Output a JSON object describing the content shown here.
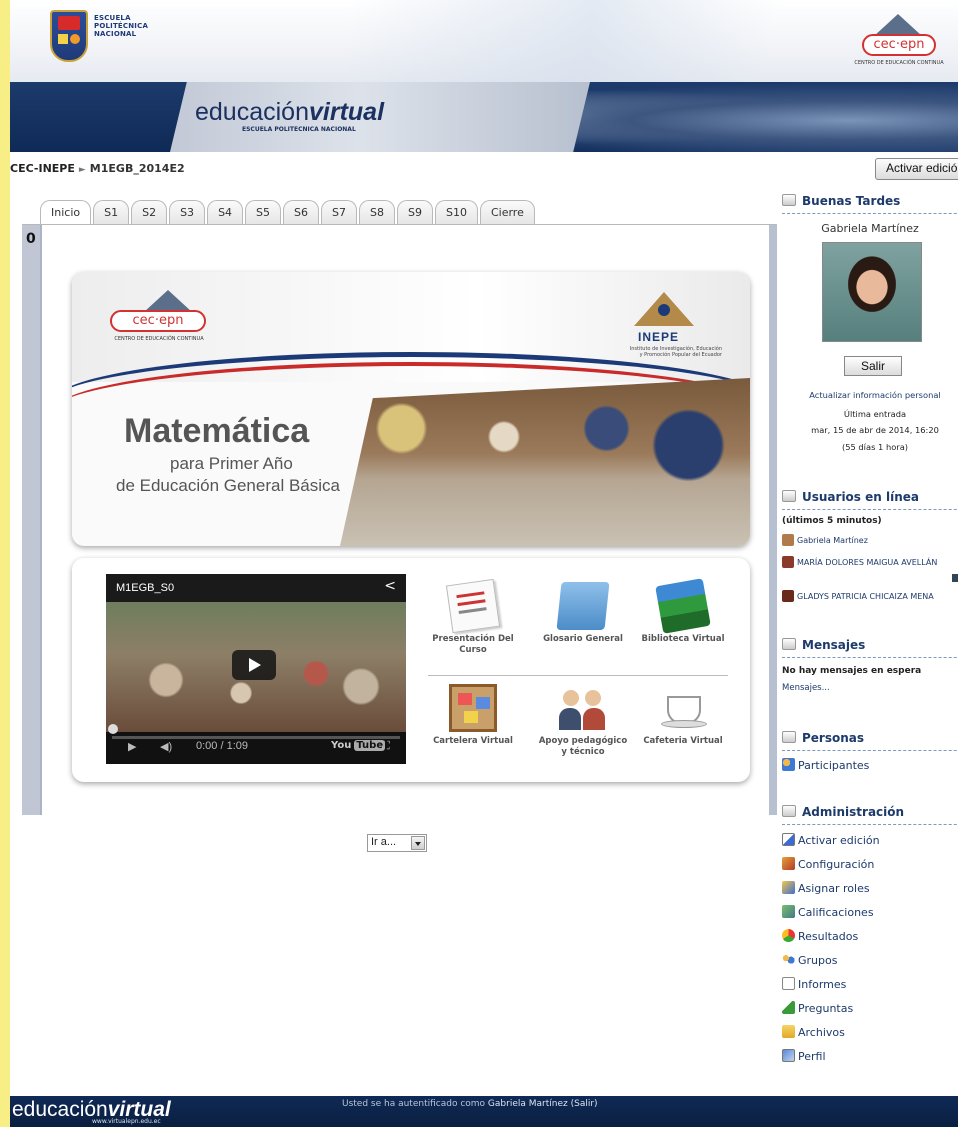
{
  "header": {
    "epn_lines": [
      "ESCUELA",
      "POLITÉCNICA",
      "NACIONAL"
    ],
    "cec_logo": "cec·epn",
    "cec_sub": "CENTRO DE EDUCACIÓN CONTINUA",
    "brand_prefix": "educación",
    "brand_bold": "virtual",
    "brand_sub": "ESCUELA POLITECNICA NACIONAL"
  },
  "breadcrumb": {
    "root": "CEC-INEPE",
    "sep": "►",
    "course": "M1EGB_2014E2"
  },
  "edit_button": "Activar edición",
  "tabs": [
    "Inicio",
    "S1",
    "S2",
    "S3",
    "S4",
    "S5",
    "S6",
    "S7",
    "S8",
    "S9",
    "S10",
    "Cierre"
  ],
  "section_number": "0",
  "banner": {
    "cec_logo": "cec·epn",
    "cec_sub": "CENTRO DE EDUCACIÓN CONTINUA",
    "inepe_name": "INEPE",
    "inepe_sub": "Instituto de Investigación, Educación y Promoción Popular del Ecuador",
    "title": "Matemática",
    "subtitle1": "para Primer Año",
    "subtitle2": "de Educación General Básica"
  },
  "video": {
    "title": "M1EGB_S0",
    "time": "0:00 / 1:09",
    "brand": "You",
    "brand2": "Tube"
  },
  "resources": [
    {
      "label": "Presentación Del Curso",
      "icon": "document-icon"
    },
    {
      "label": "Glosario General",
      "icon": "folder-icon"
    },
    {
      "label": "Biblioteca Virtual",
      "icon": "books-icon"
    },
    {
      "label": "Cartelera Virtual",
      "icon": "corkboard-icon"
    },
    {
      "label": "Apoyo pedagógico y técnico",
      "icon": "people-icon"
    },
    {
      "label": "Cafeteria Virtual",
      "icon": "coffee-cup-icon"
    }
  ],
  "goto": "Ir a...",
  "blocks": {
    "greeting": {
      "title": "Buenas Tardes",
      "user": "Gabriela Martínez",
      "logout": "Salir",
      "update_profile": "Actualizar información personal",
      "last_access_label": "Última entrada",
      "last_access_date": "mar, 15 de abr de 2014, 16:20",
      "last_access_ago": "(55 días 1 hora)"
    },
    "online": {
      "title": "Usuarios en línea",
      "subtitle": "(últimos 5 minutos)",
      "users": [
        "Gabriela Martínez",
        "MARÍA DOLORES MAIGUA AVELLÁN",
        "GLADYS PATRICIA CHICAIZA MENA"
      ]
    },
    "messages": {
      "title": "Mensajes",
      "none": "No hay mensajes en espera",
      "link": "Mensajes..."
    },
    "people": {
      "title": "Personas",
      "participants": "Participantes"
    },
    "admin": {
      "title": "Administración",
      "items": [
        "Activar edición",
        "Configuración",
        "Asignar roles",
        "Calificaciones",
        "Resultados",
        "Grupos",
        "Informes",
        "Preguntas",
        "Archivos",
        "Perfil"
      ]
    }
  },
  "footer": {
    "brand_prefix": "educación",
    "brand_bold": "virtual",
    "url": "www.virtualepn.edu.ec",
    "auth_prefix": "Usted se ha autentificado como",
    "auth_user": "Gabriela Martínez",
    "auth_logout": "(Salir)"
  },
  "colors": {
    "navy": "#0f2a56",
    "link": "#1d3a6b",
    "outer": "#f7ef86"
  }
}
